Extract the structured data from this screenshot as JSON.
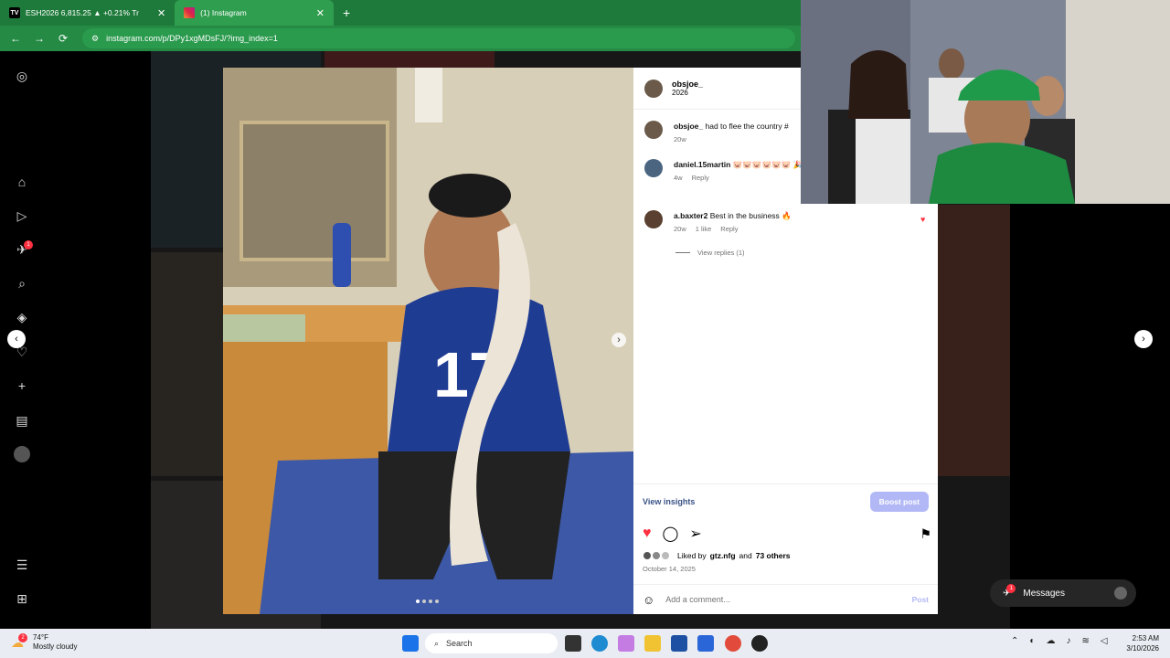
{
  "browser": {
    "tabs": [
      {
        "label": "ESH2026 6,815.25 ▲ +0.21% Tr",
        "icon": "tradingview-icon",
        "active": false
      },
      {
        "label": "(1) Instagram",
        "icon": "instagram-icon",
        "active": true
      }
    ],
    "url": "instagram.com/p/DPy1xgMDsFJ/?img_index=1"
  },
  "rail": {
    "notification_count": "1"
  },
  "post": {
    "author": "obsjoe_",
    "author_sub": "2026",
    "comments": [
      {
        "user": "obsjoe_",
        "text": "had to flee the country #",
        "time": "20w",
        "likes": "",
        "reply": ""
      },
      {
        "user": "daniel.15martin",
        "text": "🐷🐷🐷🐷🐷🐷 🎉🎉🎉🎉🎉🎉",
        "time": "4w",
        "likes": "",
        "reply": "Reply"
      },
      {
        "user": "a.baxter2",
        "text": "Best in the business 🔥",
        "time": "20w",
        "likes": "1 like",
        "reply": "Reply"
      }
    ],
    "view_replies": "View replies (1)",
    "view_insights": "View insights",
    "boost_label": "Boost post",
    "liked_by_prefix": "Liked by",
    "liked_by_user": "gtz.nfg",
    "liked_by_and": "and",
    "liked_by_others": "73 others",
    "date": "October 14, 2025",
    "comment_placeholder": "Add a comment...",
    "post_label": "Post"
  },
  "messages": {
    "label": "Messages",
    "badge": "1"
  },
  "taskbar": {
    "weather_temp": "74°F",
    "weather_desc": "Mostly cloudy",
    "weather_badge": "2",
    "search_placeholder": "Search",
    "time": "2:53 AM",
    "date": "3/10/2026"
  },
  "colors": {
    "browser_green": "#1e7a3a",
    "like_red": "#ff3040",
    "boost_blue": "#b2b8f6"
  }
}
